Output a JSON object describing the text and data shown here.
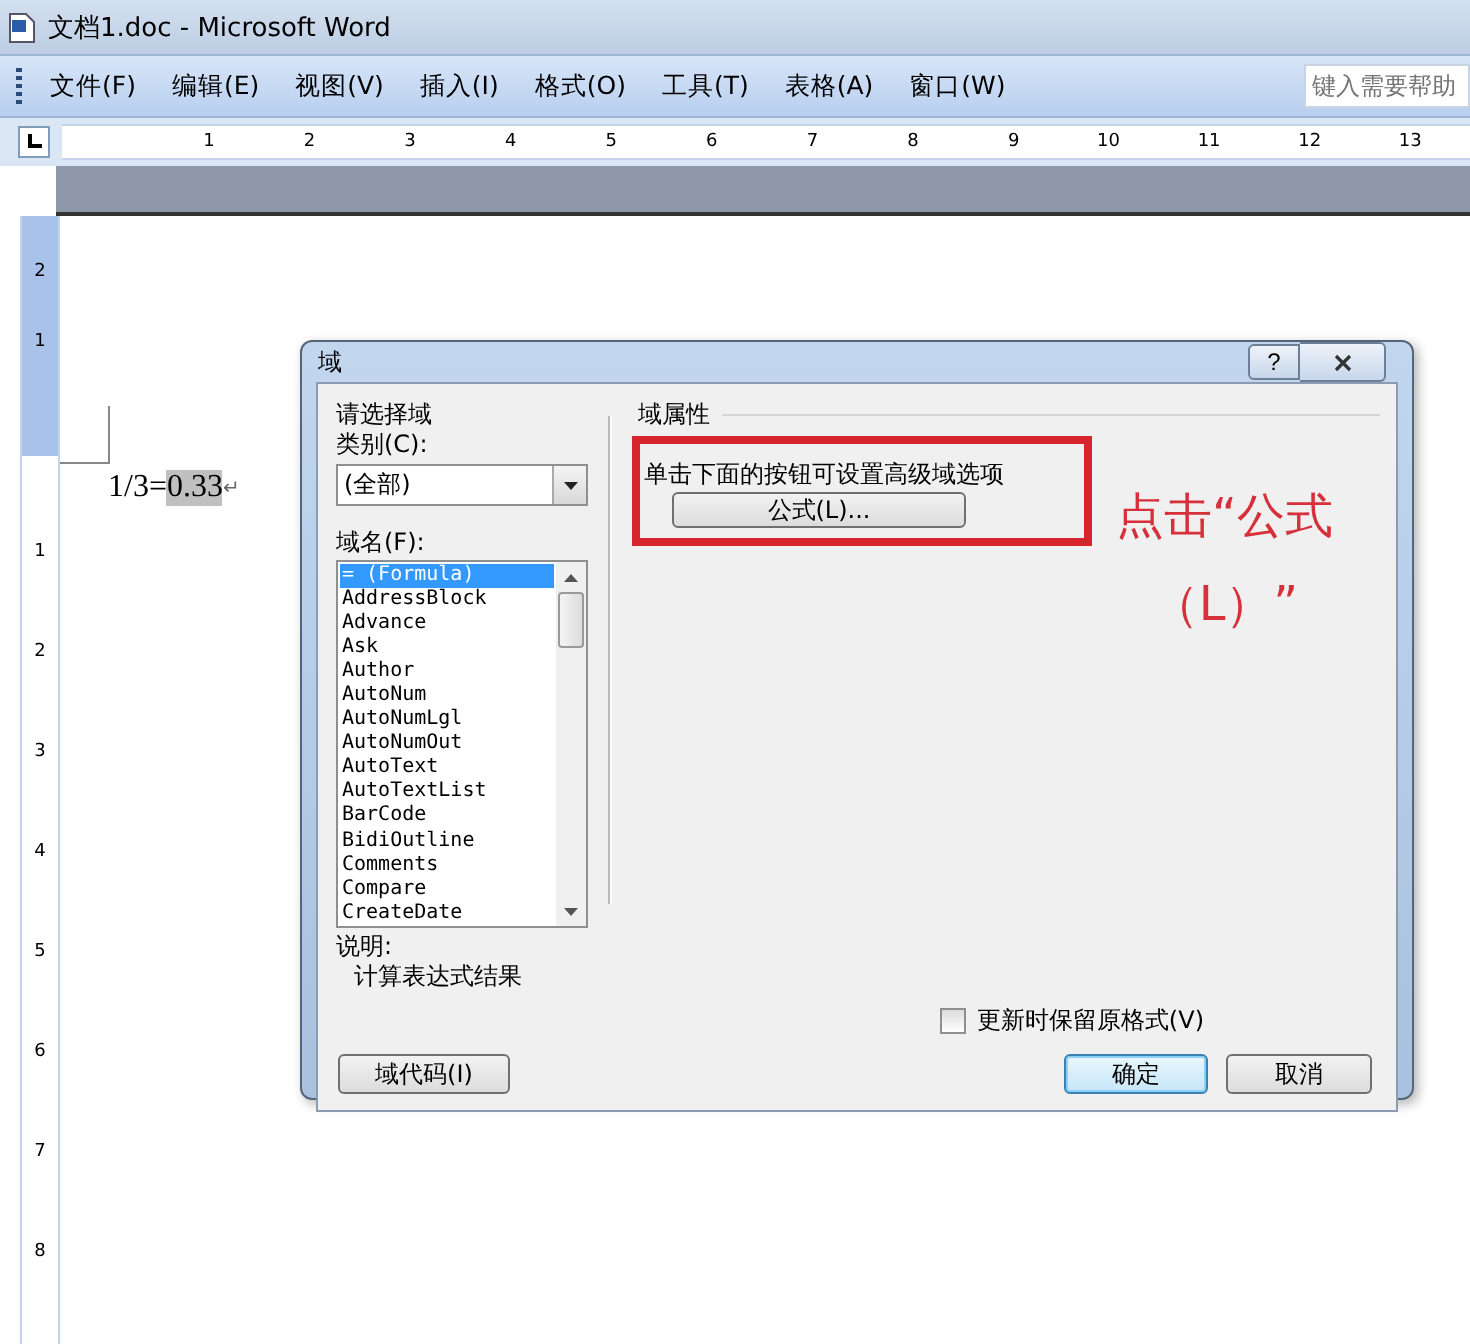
{
  "window": {
    "title": "文档1.doc - Microsoft Word"
  },
  "menu": [
    "文件(F)",
    "编辑(E)",
    "视图(V)",
    "插入(I)",
    "格式(O)",
    "工具(T)",
    "表格(A)",
    "窗口(W)"
  ],
  "help_search": {
    "placeholder": "键入需要帮助"
  },
  "ruler": {
    "numbers": [
      "1",
      "2",
      "3",
      "4",
      "5",
      "6",
      "7",
      "8",
      "9",
      "10",
      "11",
      "12",
      "13"
    ]
  },
  "vertical_ruler": {
    "top_numbers": [
      "2",
      "1"
    ],
    "numbers": [
      "1",
      "2",
      "3",
      "4",
      "5",
      "6",
      "7",
      "8"
    ]
  },
  "document": {
    "text": "1/3=",
    "field_result": "0.33",
    "paragraph_mark": "↵"
  },
  "dialog": {
    "title": "域",
    "help_button": "?",
    "left": {
      "group": "请选择域",
      "category_label": "类别(C):",
      "category_value": "(全部)",
      "names_label": "域名(F):",
      "names": [
        {
          "label": "= (Formula)",
          "selected": true
        },
        {
          "label": "AddressBlock",
          "selected": false
        },
        {
          "label": "Advance",
          "selected": false
        },
        {
          "label": "Ask",
          "selected": false
        },
        {
          "label": "Author",
          "selected": false
        },
        {
          "label": "AutoNum",
          "selected": false
        },
        {
          "label": "AutoNumLgl",
          "selected": false
        },
        {
          "label": "AutoNumOut",
          "selected": false
        },
        {
          "label": "AutoText",
          "selected": false
        },
        {
          "label": "AutoTextList",
          "selected": false
        },
        {
          "label": "BarCode",
          "selected": false
        },
        {
          "label": "BidiOutline",
          "selected": false
        },
        {
          "label": "Comments",
          "selected": false
        },
        {
          "label": "Compare",
          "selected": false
        },
        {
          "label": "CreateDate",
          "selected": false
        }
      ],
      "description_label": "说明:",
      "description": "计算表达式结果"
    },
    "right": {
      "group": "域属性",
      "hint": "单击下面的按钮可设置高级域选项",
      "formula_button": "公式(L)..."
    },
    "preserve_format": {
      "label": "更新时保留原格式(V)",
      "checked": false
    },
    "field_codes_button": "域代码(I)",
    "buttons": [
      {
        "label": "确定",
        "focused": true
      },
      {
        "label": "取消",
        "focused": false
      }
    ]
  },
  "annotation": {
    "lines": [
      "点击“公式",
      "（L）”"
    ]
  }
}
